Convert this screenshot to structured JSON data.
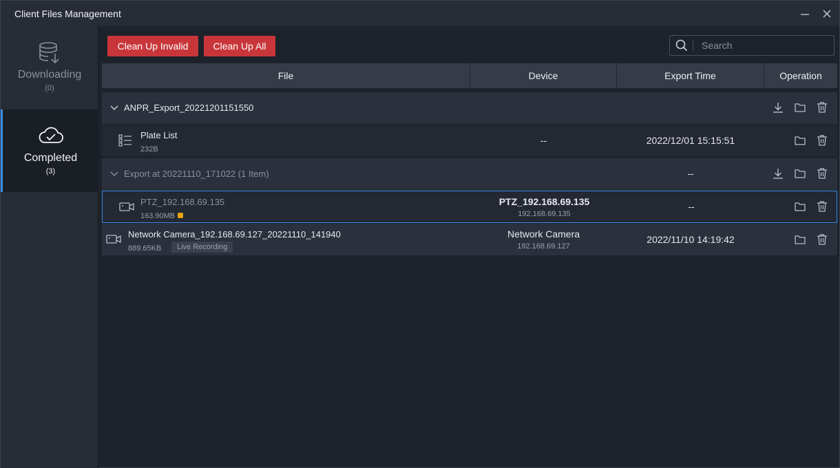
{
  "window": {
    "title": "Client Files Management"
  },
  "sidebar": {
    "items": [
      {
        "label": "Downloading",
        "count": "(0)"
      },
      {
        "label": "Completed",
        "count": "(3)"
      }
    ]
  },
  "toolbar": {
    "clean_invalid_label": "Clean Up Invalid",
    "clean_all_label": "Clean Up All",
    "search_placeholder": "Search"
  },
  "table": {
    "columns": [
      "File",
      "Device",
      "Export Time",
      "Operation"
    ],
    "groups": [
      {
        "name": "ANPR_Export_20221201151550",
        "rows": [
          {
            "name": "Plate List",
            "size": "232B",
            "device": "--",
            "time": "2022/12/01 15:15:51"
          }
        ]
      },
      {
        "name": "Export at 20221110_171022 (1 Item)",
        "time": "--",
        "rows": [
          {
            "name": "PTZ_192.168.69.135",
            "size": "163.90MB",
            "device": "PTZ_192.168.69.135",
            "device_ip": "192.168.69.135",
            "time": "--"
          }
        ]
      }
    ],
    "standalone": {
      "name": "Network Camera_192.168.69.127_20221110_141940",
      "size": "889.65KB",
      "tag": "Live Recording",
      "device": "Network Camera",
      "device_ip": "192.168.69.127",
      "time": "2022/11/10 14:19:42"
    }
  },
  "colors": {
    "accent": "#3a8ee6",
    "danger": "#c8363a",
    "warning": "#e6a417"
  }
}
